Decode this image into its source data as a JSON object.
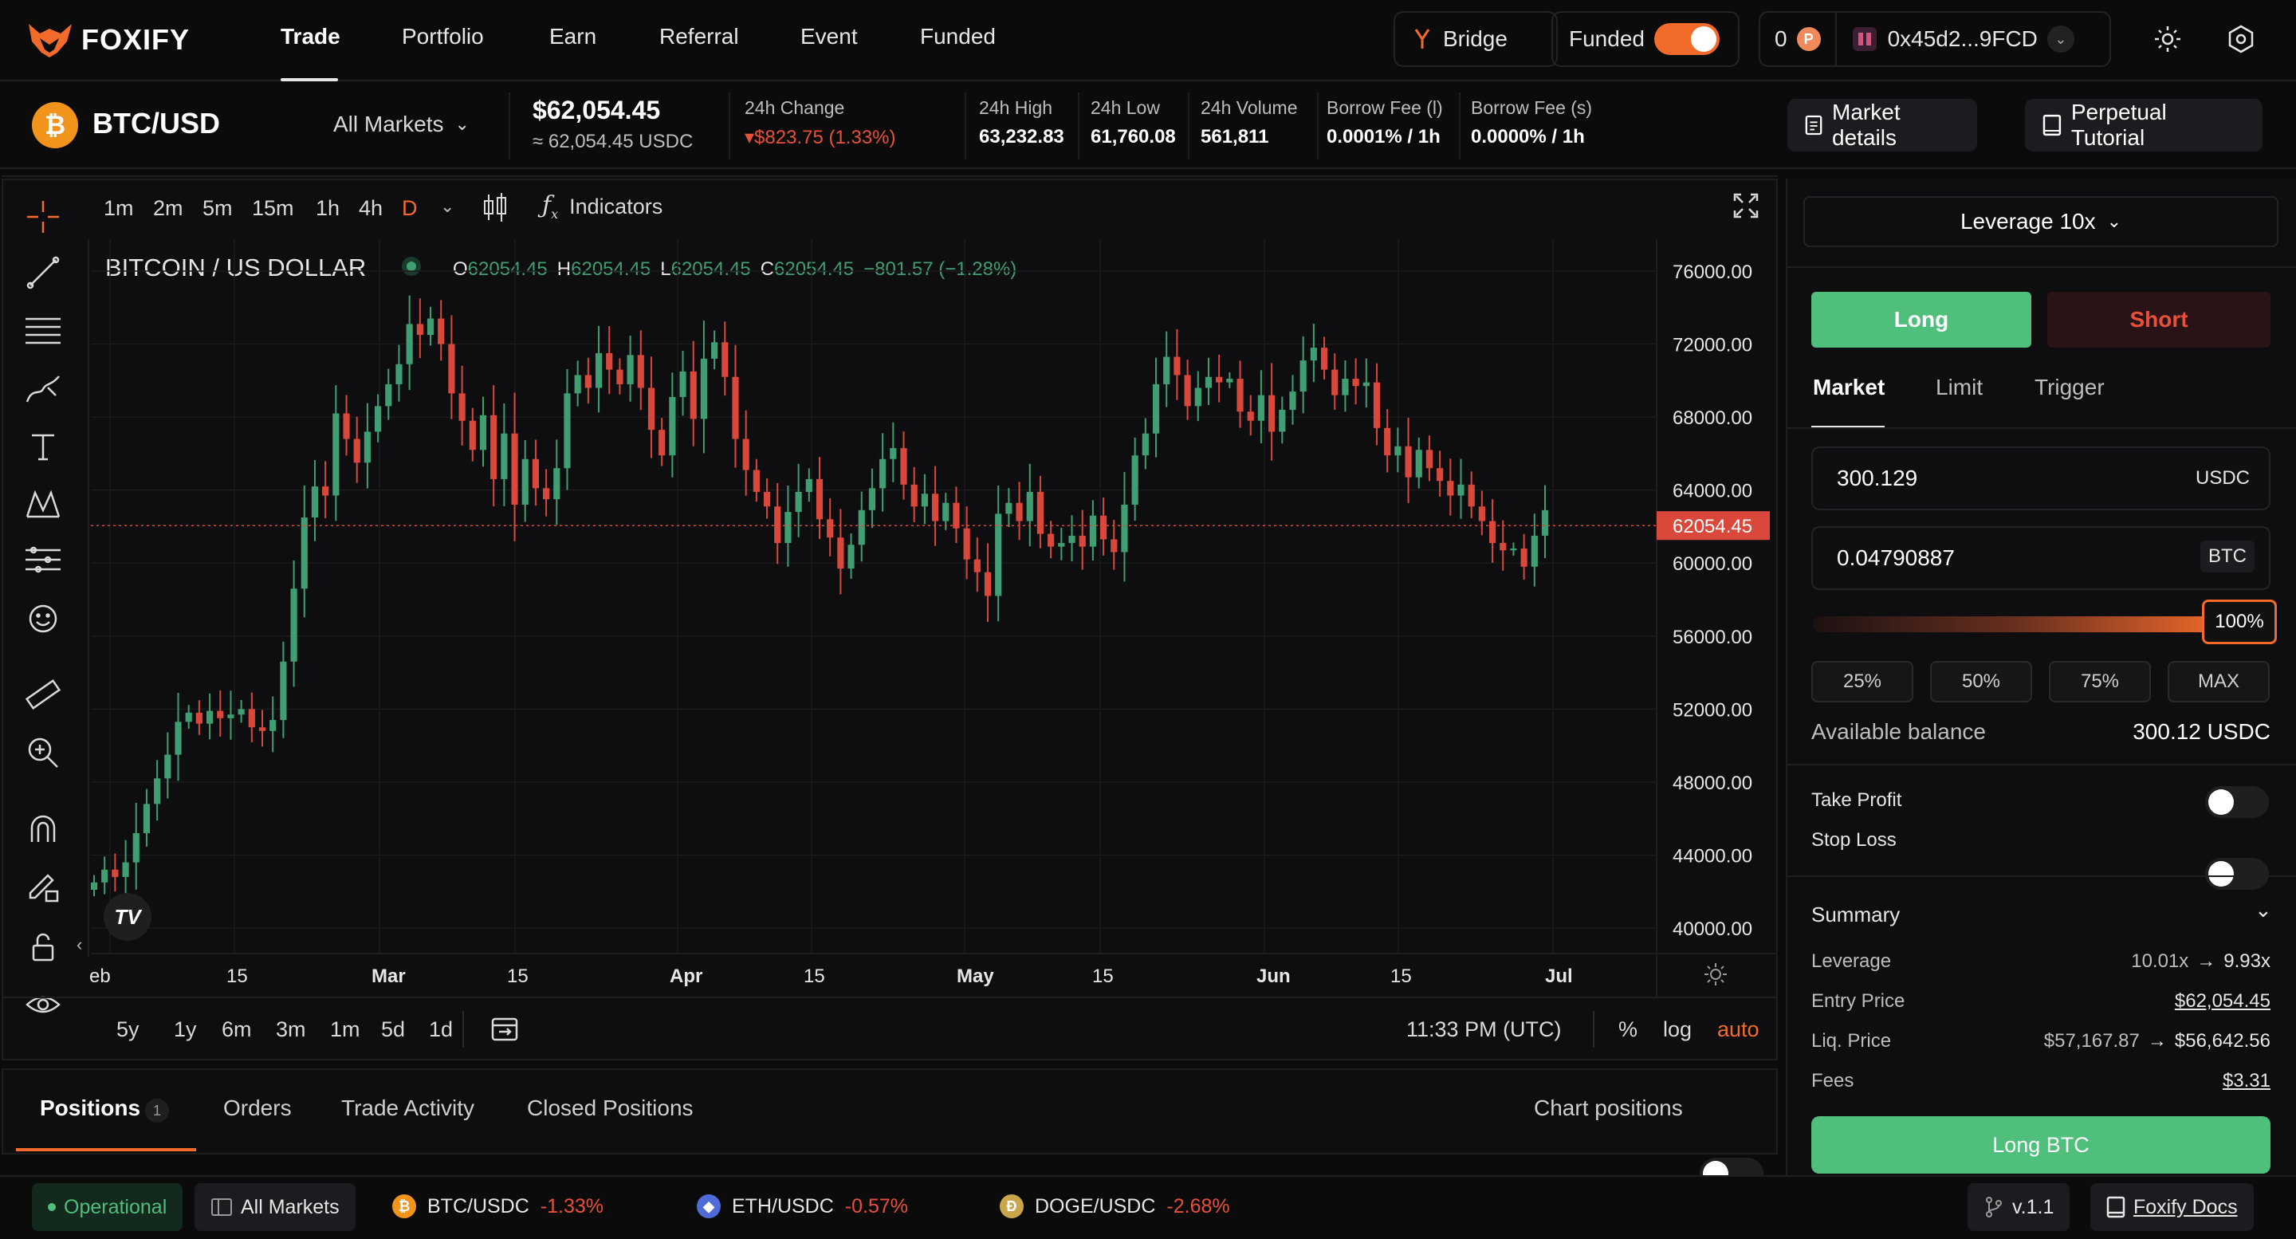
{
  "app": {
    "brand": "FOXIFY"
  },
  "nav": {
    "items": [
      "Trade",
      "Portfolio",
      "Earn",
      "Referral",
      "Event",
      "Funded"
    ]
  },
  "topbar": {
    "bridge_label": "Bridge",
    "funded_label": "Funded",
    "points": "0",
    "wallet": "0x45d2...9FCD"
  },
  "market": {
    "pair": "BTC/USD",
    "selector": "All Markets",
    "price": "$62,054.45",
    "price_usdc": "≈ 62,054.45 USDC",
    "stats": [
      {
        "label": "24h Change",
        "value": "▾$823.75 (1.33%)"
      },
      {
        "label": "24h High",
        "value": "63,232.83"
      },
      {
        "label": "24h Low",
        "value": "61,760.08"
      },
      {
        "label": "24h Volume",
        "value": "561,811"
      },
      {
        "label": "Borrow Fee (l)",
        "value": "0.0001% / 1h"
      },
      {
        "label": "Borrow Fee (s)",
        "value": "0.0000% / 1h"
      }
    ],
    "market_details": "Market details",
    "tutorial": "Perpetual Tutorial"
  },
  "chart_toolbar": {
    "timeframes": [
      "1m",
      "2m",
      "5m",
      "15m",
      "1h",
      "4h",
      "D"
    ],
    "indicators": "Indicators"
  },
  "chart_data": {
    "type": "candlestick",
    "title": "BITCOIN / US DOLLAR",
    "ohlc_legend": {
      "O": "62054.45",
      "H": "62054.45",
      "L": "62054.45",
      "C": "62054.45",
      "change": "−801.57 (−1.28%)"
    },
    "y_ticks": [
      "76000.00",
      "72000.00",
      "68000.00",
      "64000.00",
      "60000.00",
      "56000.00",
      "52000.00",
      "48000.00",
      "44000.00",
      "40000.00"
    ],
    "ylim": [
      39000,
      77500
    ],
    "x_ticks": [
      "eb",
      "15",
      "Mar",
      "15",
      "Apr",
      "15",
      "May",
      "15",
      "Jun",
      "15",
      "Jul"
    ],
    "last_price": 62054.45,
    "last_price_label": "62054.45",
    "colors": {
      "up": "#3f9f72",
      "down": "#d9483b"
    },
    "closes": [
      42500,
      43200,
      42800,
      43600,
      45200,
      46800,
      48200,
      49500,
      51300,
      51800,
      51200,
      51900,
      51500,
      51700,
      52000,
      51000,
      50800,
      51400,
      54600,
      58600,
      62500,
      64200,
      63700,
      68200,
      66800,
      65500,
      67200,
      68600,
      69800,
      70900,
      73100,
      72500,
      73400,
      72000,
      69300,
      67800,
      66200,
      68100,
      64600,
      67100,
      63200,
      65700,
      64100,
      63500,
      65200,
      69300,
      70300,
      69600,
      71500,
      70600,
      69800,
      71400,
      69600,
      67300,
      65900,
      69100,
      70500,
      67900,
      71200,
      72100,
      70200,
      66800,
      65100,
      63900,
      63100,
      61100,
      62800,
      63900,
      64600,
      62400,
      61400,
      59700,
      61000,
      62900,
      64100,
      65700,
      66300,
      64300,
      63100,
      63800,
      62300,
      63300,
      61900,
      60200,
      59500,
      58200,
      62700,
      63300,
      62300,
      63900,
      61600,
      60900,
      61100,
      61500,
      60900,
      62600,
      61300,
      60600,
      63200,
      65900,
      67100,
      69800,
      71300,
      70300,
      68600,
      69600,
      70200,
      69900,
      70100,
      68300,
      67800,
      69200,
      67200,
      68400,
      69400,
      71100,
      71800,
      70600,
      69200,
      70100,
      69700,
      69900,
      67400,
      65900,
      66400,
      64700,
      66200,
      65200,
      64500,
      63700,
      64300,
      63100,
      62300,
      61100,
      60700,
      60800,
      59800,
      61500,
      62900
    ]
  },
  "chart_bottom": {
    "ranges": [
      "5y",
      "1y",
      "6m",
      "3m",
      "1m",
      "5d",
      "1d"
    ],
    "time": "11:33 PM (UTC)",
    "percent": "%",
    "log": "log",
    "auto": "auto"
  },
  "order": {
    "leverage": "Leverage 10x",
    "long": "Long",
    "short": "Short",
    "order_types": [
      "Market",
      "Limit",
      "Trigger"
    ],
    "pay_amount": "300.129",
    "pay_token": "USDC",
    "size_amount": "0.04790887",
    "size_token": "BTC",
    "slider_label": "100%",
    "slider_fraction": 1.0,
    "pct_buttons": [
      "25%",
      "50%",
      "75%",
      "MAX"
    ],
    "available_label": "Available balance",
    "available_value": "300.12 USDC",
    "take_profit": "Take Profit",
    "stop_loss": "Stop Loss",
    "summary_title": "Summary",
    "summary": [
      {
        "label": "Leverage",
        "from": "10.01x",
        "to": "9.93x"
      },
      {
        "label": "Entry Price",
        "value": "$62,054.45"
      },
      {
        "label": "Liq. Price",
        "from": "$57,167.87",
        "to": "$56,642.56"
      },
      {
        "label": "Fees",
        "value": "$3.31"
      }
    ],
    "submit": "Long BTC"
  },
  "positions": {
    "tabs": [
      "Positions",
      "Orders",
      "Trade Activity",
      "Closed Positions"
    ],
    "count": "1",
    "chart_positions": "Chart positions"
  },
  "footer": {
    "status": "Operational",
    "all_markets": "All Markets",
    "tickers": [
      {
        "pair": "BTC/USDC",
        "change": "-1.33%"
      },
      {
        "pair": "ETH/USDC",
        "change": "-0.57%"
      },
      {
        "pair": "DOGE/USDC",
        "change": "-2.68%"
      }
    ],
    "version": "v.1.1",
    "docs": "Foxify Docs"
  }
}
